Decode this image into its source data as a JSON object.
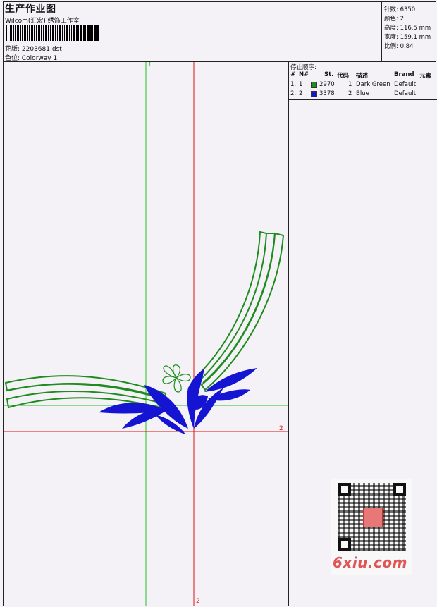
{
  "header": {
    "title": "生产作业图",
    "subtitle": "Wilcom(汇宏) 绣饰工作室",
    "design_label": "花版: 2203681.dst",
    "colorway_label": "色位: Colorway 1"
  },
  "info": {
    "stitches": "针数: 6350",
    "colors": "颜色: 2",
    "height": "高度: 116.5 mm",
    "width": "宽度: 159.1 mm",
    "scale": "比例: 0.84"
  },
  "sequence": {
    "title": "停止顺序:",
    "columns": [
      "#",
      "N#",
      "St.",
      "代码",
      "描述",
      "Brand",
      "元素"
    ],
    "rows": [
      {
        "num": "1.",
        "n": "1",
        "color": "#1e8c1e",
        "st": "2970",
        "code": "1",
        "desc": "Dark Green",
        "brand": "Default"
      },
      {
        "num": "2.",
        "n": "2",
        "color": "#1414d2",
        "st": "3378",
        "code": "2",
        "desc": "Blue",
        "brand": "Default"
      }
    ]
  },
  "axes": {
    "green_label": "1",
    "red_label_right": "2",
    "red_label_bottom": "2"
  },
  "watermark": {
    "text": "6xiu.com"
  },
  "colors": {
    "thread_green": "#1e8c1e",
    "thread_blue": "#1414d2",
    "axis_red": "#e01010",
    "axis_green": "#22c022"
  }
}
